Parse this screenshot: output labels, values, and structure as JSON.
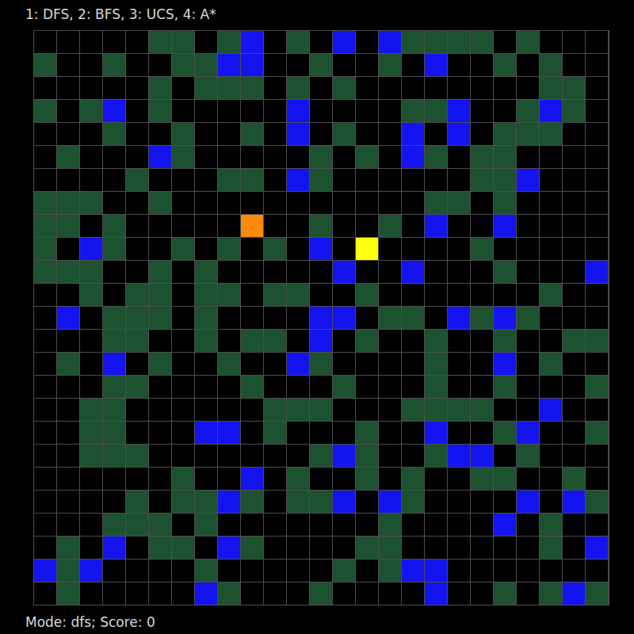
{
  "header": "1: DFS, 2: BFS, 3: UCS, 4: A*",
  "grid": {
    "rows": [
      ".....GG.GB.G.B.BGGGG.G...",
      "G..G..GGBB..G..G.B..G.G..",
      ".....G.GGG.G.G........GG.",
      "G.GB.G.....B....GGB..GBG.",
      "...G..G..G.B.G..B.B.GGG..",
      ".G...BG.....G.G.BG.GG....",
      "....G...GG.BG......GGB...",
      "GGG..G...........GG.G....",
      "GG.G.....A..G..G.B..B....",
      "G.BG..G.G.G.B.Y....G.....",
      "GGG..G.G.....B..B...G...B",
      "..G.GG.GG.GG..G.......G..",
      ".B.GGG.G....BB.GG.BGBG...",
      "...GG..G.GG.B.G..G..G..GG",
      ".G.B.G..G..BG....G..B.G..",
      "...GG....G...G...G..G...G",
      "..GG......GGG...GGGG..B..",
      "..GG...BB.G...G..B..GB..G",
      "..GGG.......GBG..GBB.G...",
      "......G..B.G..G.G..GG..G.",
      "....G.GGBG.GGB.BG....B.BG",
      "...GGG.G.......G....B.G..",
      ".G.B.GG.BG....GG......G.B",
      "BGB....G.....G.GBB.......",
      ".G.....BG...G....B..G.GBG"
    ]
  },
  "status": "Mode: dfs; Score: 0"
}
